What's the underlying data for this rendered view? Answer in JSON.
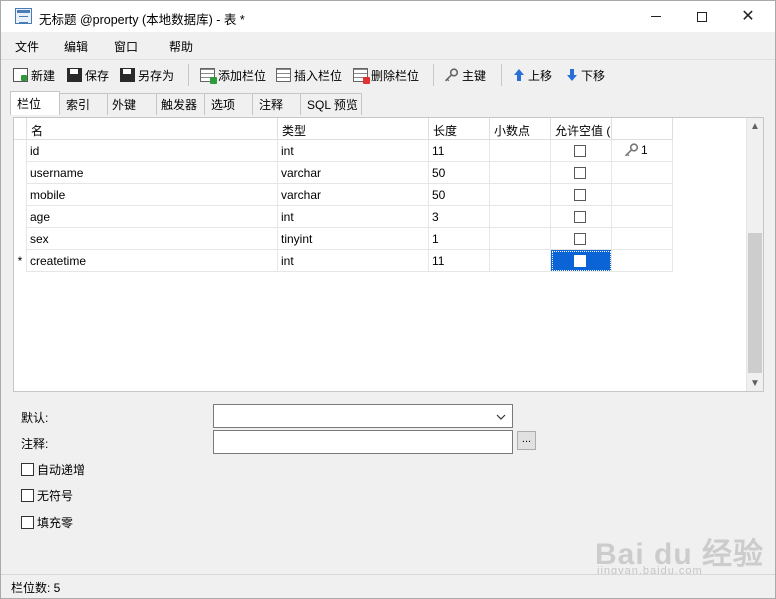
{
  "window": {
    "title": "无标题 @property (本地数据库) - 表 *"
  },
  "menu": [
    "文件",
    "编辑",
    "窗口",
    "帮助"
  ],
  "toolbar": {
    "new": "新建",
    "save": "保存",
    "save_as": "另存为",
    "add_field": "添加栏位",
    "insert_field": "插入栏位",
    "delete_field": "删除栏位",
    "primary_key": "主键",
    "move_up": "上移",
    "move_down": "下移"
  },
  "tabs": [
    "栏位",
    "索引",
    "外键",
    "触发器",
    "选项",
    "注释",
    "SQL 预览"
  ],
  "grid": {
    "headers": [
      "名",
      "类型",
      "长度",
      "小数点",
      "允许空值 (",
      ""
    ],
    "rows": [
      {
        "marker": "",
        "name": "id",
        "type": "int",
        "length": "11",
        "decimals": "",
        "allow_null": false,
        "key": "1"
      },
      {
        "marker": "",
        "name": "username",
        "type": "varchar",
        "length": "50",
        "decimals": "",
        "allow_null": false,
        "key": ""
      },
      {
        "marker": "",
        "name": "mobile",
        "type": "varchar",
        "length": "50",
        "decimals": "",
        "allow_null": false,
        "key": ""
      },
      {
        "marker": "",
        "name": "age",
        "type": "int",
        "length": "3",
        "decimals": "",
        "allow_null": false,
        "key": ""
      },
      {
        "marker": "",
        "name": "sex",
        "type": "tinyint",
        "length": "1",
        "decimals": "",
        "allow_null": false,
        "key": ""
      },
      {
        "marker": "*",
        "name": "createtime",
        "type": "int",
        "length": "11",
        "decimals": "",
        "allow_null": false,
        "key": ""
      }
    ]
  },
  "properties": {
    "default_label": "默认:",
    "default_value": "",
    "comment_label": "注释:",
    "comment_value": "",
    "ellipsis": "...",
    "options": [
      "自动递增",
      "无符号",
      "填充零"
    ]
  },
  "status": {
    "field_count": "栏位数: 5"
  },
  "watermark": {
    "text": "Bai du 经验",
    "sub": "jingyan.baidu.com"
  },
  "colors": {
    "selection": "#0a64d6",
    "accent_green": "#2e9b3a",
    "accent_red": "#d33333"
  }
}
